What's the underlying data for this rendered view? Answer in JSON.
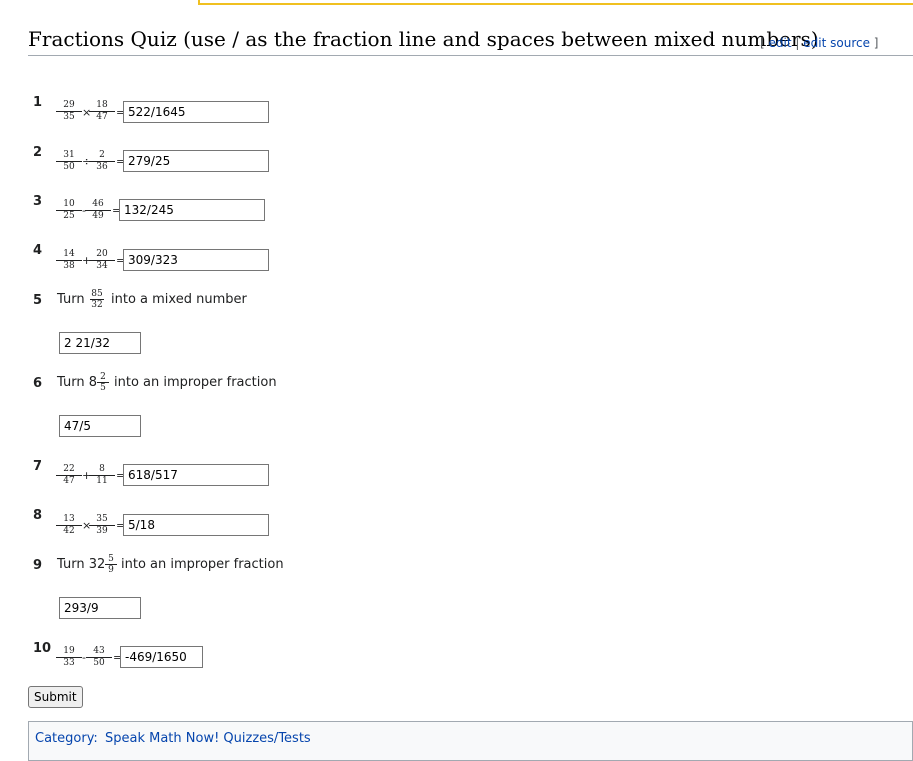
{
  "section": {
    "title": "Fractions Quiz (use / as the fraction line and spaces between mixed numbers)",
    "edit_open": "[",
    "edit_label": "edit",
    "sep": "|",
    "edit_source_label": "edit source",
    "edit_close": "]"
  },
  "questions": [
    {
      "n": "1",
      "a_num": "29",
      "a_den": "35",
      "op": "×",
      "b_num": "18",
      "b_den": "47",
      "eq": "=",
      "answer": "522/1645"
    },
    {
      "n": "2",
      "a_num": "31",
      "a_den": "50",
      "op": "÷",
      "b_num": "2",
      "b_den": "36",
      "eq": "=",
      "answer": "279/25"
    },
    {
      "n": "3",
      "a_num": "10",
      "a_den": "25",
      "op": "-",
      "b_num": "46",
      "b_den": "49",
      "eq": "=",
      "answer": "132/245"
    },
    {
      "n": "4",
      "a_num": "14",
      "a_den": "38",
      "op": "+",
      "b_num": "20",
      "b_den": "34",
      "eq": "=",
      "answer": "309/323"
    },
    {
      "n": "5",
      "pre": "Turn",
      "num": "85",
      "den": "32",
      "post": "into a mixed number",
      "answer": "2 21/32"
    },
    {
      "n": "6",
      "pre": "Turn 8",
      "num": "2",
      "den": "5",
      "post": "into an improper fraction",
      "answer": "47/5"
    },
    {
      "n": "7",
      "a_num": "22",
      "a_den": "47",
      "op": "+",
      "b_num": "8",
      "b_den": "11",
      "eq": "=",
      "answer": "618/517"
    },
    {
      "n": "8",
      "a_num": "13",
      "a_den": "42",
      "op": "×",
      "b_num": "35",
      "b_den": "39",
      "eq": "=",
      "answer": "5/18"
    },
    {
      "n": "9",
      "pre": "Turn 32",
      "num": "5",
      "den": "9",
      "post": "into an improper fraction",
      "answer": "293/9"
    },
    {
      "n": "10",
      "a_num": "19",
      "a_den": "33",
      "op": "-",
      "b_num": "43",
      "b_den": "50",
      "eq": "=",
      "answer": "-469/1650"
    }
  ],
  "submit_label": "Submit",
  "category": {
    "label": "Category:",
    "link": "Speak Math Now! Quizzes/Tests"
  }
}
